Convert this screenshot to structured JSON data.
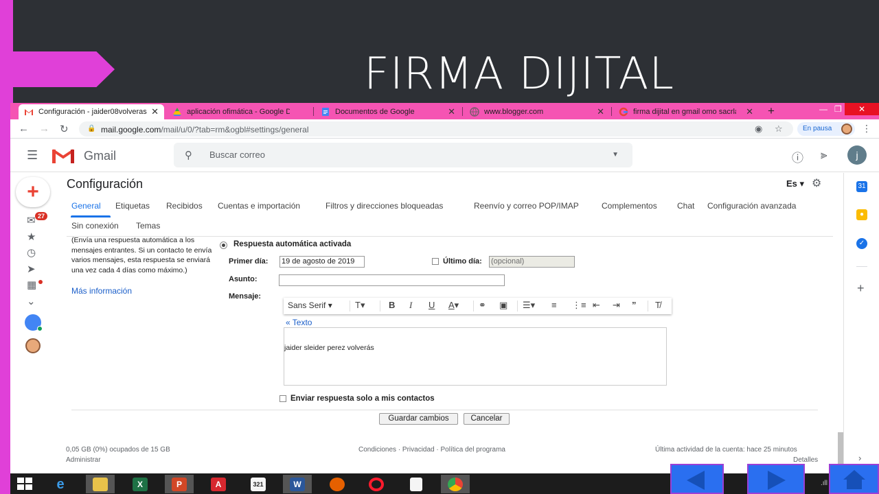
{
  "slide": {
    "title": "FIRMA DIJITAL",
    "colors": {
      "accent": "#e040d8",
      "background": "#2d3035",
      "nav_button": "#2a6ff0"
    }
  },
  "browser": {
    "tabs": [
      {
        "label": "Configuración - jaider08volveras",
        "icon": "gmail-icon",
        "active": true
      },
      {
        "label": "aplicación ofimática - Google Drive",
        "icon": "drive-icon"
      },
      {
        "label": "Documentos de Google",
        "icon": "docs-icon"
      },
      {
        "label": "www.blogger.com",
        "icon": "globe-icon"
      },
      {
        "label": "firma dijital en gmail omo sacrla",
        "icon": "google-icon"
      }
    ],
    "tab_close": "✕",
    "new_tab": "+",
    "url_host": "mail.google.com",
    "url_path": "/mail/u/0/?tab=rm&ogbl#settings/general",
    "paused_label": "En pausa"
  },
  "gmail": {
    "logo_text": "Gmail",
    "search_placeholder": "Buscar correo",
    "avatar_letter": "j",
    "unread_count": "27",
    "settings_title": "Configuración",
    "lang": "Es",
    "tabs": [
      "General",
      "Etiquetas",
      "Recibidos",
      "Cuentas e importación",
      "Filtros y direcciones bloqueadas",
      "Reenvío y correo POP/IMAP",
      "Complementos",
      "Chat",
      "Configuración avanzada",
      "Sin conexión",
      "Temas"
    ],
    "help_text": "(Envía una respuesta automática a los mensajes entrantes. Si un contacto te envía varios mensajes, esta respuesta se enviará una vez cada 4 días como máximo.)",
    "more_info": "Más información",
    "auto_reply_label": "Respuesta automática activada",
    "first_day_label": "Primer día:",
    "first_day_value": "19 de agosto de 2019",
    "last_day_label": "Último día:",
    "last_day_placeholder": "(opcional)",
    "subject_label": "Asunto:",
    "message_label": "Mensaje:",
    "font_name": "Sans Serif",
    "text_link": "« Texto",
    "message_body": "jaider sleider perez volverás",
    "contacts_only_label": "Enviar respuesta solo a mis contactos",
    "save_button": "Guardar cambios",
    "cancel_button": "Cancelar",
    "footer": {
      "storage": "0,05 GB (0%) ocupados de 15 GB",
      "manage": "Administrar",
      "links": "Condiciones · Privacidad · Política del programa",
      "last_activity": "Última actividad de la cuenta: hace 25 minutos",
      "details": "Detalles"
    }
  },
  "taskbar": {
    "apps": [
      "start-icon",
      "ie-icon",
      "file-explorer-icon",
      "excel-icon",
      "powerpoint-icon",
      "acrobat-icon",
      "media-icon",
      "word-icon",
      "firefox-icon",
      "opera-icon",
      "notepad-icon",
      "chrome-icon"
    ]
  }
}
